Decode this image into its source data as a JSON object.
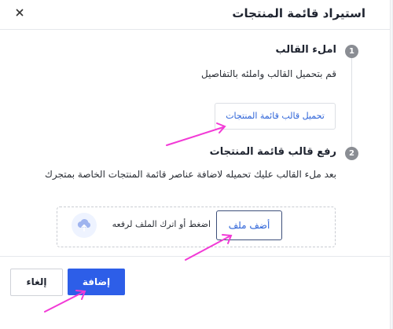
{
  "dialog": {
    "title": "استيراد قائمة المنتجات",
    "close_icon": "close-icon"
  },
  "steps": [
    {
      "number": "1",
      "title": "املء القالب",
      "description": "قم بتحميل القالب واملئه بالتفاصيل",
      "button_label": "تحميل قالب قائمة المنتجات"
    },
    {
      "number": "2",
      "title": "رفع قالب قائمة المنتجات",
      "description": "بعد ملء القالب عليك تحميله لاضافة عناصر قائمة المنتجات الخاصة بمتجرك",
      "button_label": "أضف ملف",
      "dropzone_text": "اضغط أو اترك الملف لرفعه",
      "icon": "cloud-upload-icon"
    }
  ],
  "footer": {
    "cancel_label": "إلغاء",
    "submit_label": "إضافة"
  },
  "colors": {
    "primary": "#2d5ee8",
    "link": "#2d63d8",
    "annotation_arrow": "#f23ad6",
    "step_circle": "#8a8d93"
  }
}
